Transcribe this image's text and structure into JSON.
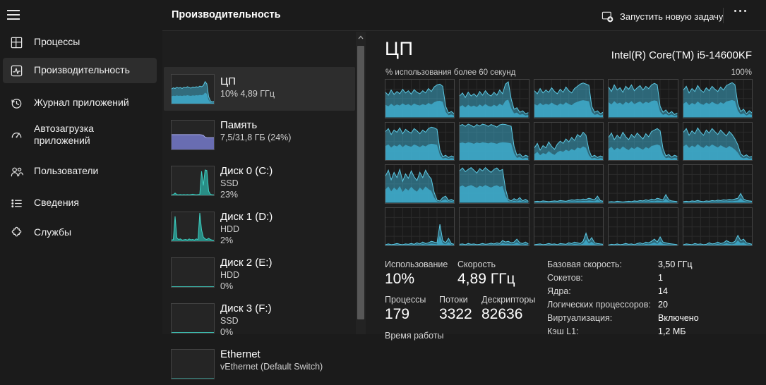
{
  "topbar": {
    "title": "Производительность",
    "run_new_task": "Запустить новую задачу"
  },
  "sidebar": {
    "items": [
      {
        "label": "Процессы",
        "icon": "processes-icon"
      },
      {
        "label": "Производительность",
        "icon": "performance-icon",
        "selected": true
      },
      {
        "label": "Журнал приложений",
        "icon": "app-history-icon"
      },
      {
        "label": "Автозагрузка приложений",
        "icon": "startup-apps-icon"
      },
      {
        "label": "Пользователи",
        "icon": "users-icon"
      },
      {
        "label": "Сведения",
        "icon": "details-icon"
      },
      {
        "label": "Службы",
        "icon": "services-icon"
      }
    ]
  },
  "perf_list": {
    "items": [
      {
        "title": "ЦП",
        "line1": "10% 4,89 ГГц"
      },
      {
        "title": "Память",
        "line1": "7,5/31,8 ГБ (24%)"
      },
      {
        "title": "Диск 0 (C:)",
        "line1": "SSD",
        "line2": "23%"
      },
      {
        "title": "Диск 1 (D:)",
        "line1": "HDD",
        "line2": "2%"
      },
      {
        "title": "Диск 2 (E:)",
        "line1": "HDD",
        "line2": "0%"
      },
      {
        "title": "Диск 3 (F:)",
        "line1": "SSD",
        "line2": "0%"
      },
      {
        "title": "Ethernet",
        "line1": "vEthernet (Default Switch)"
      }
    ]
  },
  "cpu_panel": {
    "title": "ЦП",
    "cpu_name": "Intel(R) Core(TM) i5-14600KF",
    "axis_label": "% использования более 60 секунд",
    "axis_max": "100%",
    "stats_usage": {
      "label": "Использование",
      "value": "10%"
    },
    "stats_speed": {
      "label": "Скорость",
      "value": "4,89 ГГц"
    },
    "stats_processes": {
      "label": "Процессы",
      "value": "179"
    },
    "stats_threads": {
      "label": "Потоки",
      "value": "3322"
    },
    "stats_handles": {
      "label": "Дескрипторы",
      "value": "82636"
    },
    "uptime_label": "Время работы",
    "stats_right": [
      {
        "label": "Базовая скорость:",
        "value": "3,50 ГГц"
      },
      {
        "label": "Сокетов:",
        "value": "1"
      },
      {
        "label": "Ядра:",
        "value": "14"
      },
      {
        "label": "Логических процессоров:",
        "value": "20"
      },
      {
        "label": "Виртуализация:",
        "value": "Включено"
      },
      {
        "label": "Кэш L1:",
        "value": "1,2 МБ"
      }
    ]
  },
  "icons": {
    "topbar": [
      "run-new-task-icon",
      "more-icon"
    ],
    "scrollbar": [
      "chevron-up-icon"
    ],
    "window": [
      "hamburger-menu-icon"
    ]
  },
  "colors": {
    "cpu_fill": "#3ea7c7",
    "cpu_stroke": "#5cc8e2",
    "memory_fill": "#7b80d6",
    "memory_stroke": "#a6aae9",
    "disk_fill": "#2aa79d",
    "disk_stroke": "#3fd0c2",
    "selection_bg": "#2d2d2d",
    "panel_bg": "#1e1e1e"
  },
  "chart_data": {
    "type": "area",
    "title": "% использования более 60 секунд",
    "ylim": [
      0,
      100
    ],
    "grid": true,
    "cores": [
      [
        68,
        60,
        74,
        62,
        70,
        64,
        76,
        66,
        72,
        63,
        75,
        68,
        64,
        72,
        66,
        78,
        70,
        82,
        88,
        90,
        84,
        30,
        12,
        16,
        10
      ],
      [
        58,
        66,
        54,
        68,
        58,
        64,
        56,
        70,
        60,
        72,
        62,
        58,
        68,
        60,
        74,
        64,
        90,
        96,
        50,
        22,
        26,
        14,
        18,
        10,
        13
      ],
      [
        72,
        64,
        78,
        66,
        74,
        68,
        80,
        70,
        64,
        76,
        68,
        82,
        72,
        66,
        78,
        84,
        90,
        93,
        90,
        87,
        30,
        14,
        18,
        10,
        14
      ],
      [
        82,
        70,
        88,
        74,
        80,
        68,
        84,
        76,
        88,
        72,
        80,
        86,
        74,
        84,
        78,
        88,
        92,
        88,
        30,
        14,
        20,
        10,
        16,
        8,
        12
      ],
      [
        74,
        84,
        66,
        78,
        70,
        86,
        74,
        68,
        80,
        72,
        84,
        76,
        70,
        82,
        74,
        86,
        90,
        94,
        88,
        36,
        16,
        22,
        10,
        18,
        12
      ],
      [
        78,
        86,
        70,
        82,
        76,
        88,
        72,
        84,
        78,
        74,
        86,
        80,
        72,
        82,
        76,
        86,
        90,
        88,
        84,
        28,
        10,
        14,
        8,
        12,
        9
      ],
      [
        94,
        97,
        92,
        98,
        95,
        90,
        97,
        93,
        98,
        96,
        92,
        97,
        94,
        90,
        96,
        98,
        97,
        95,
        92,
        38,
        14,
        18,
        9,
        14,
        11
      ],
      [
        34,
        46,
        28,
        40,
        34,
        50,
        38,
        30,
        44,
        52,
        46,
        58,
        50,
        62,
        54,
        70,
        64,
        76,
        68,
        28,
        10,
        14,
        8,
        12,
        9
      ],
      [
        62,
        74,
        56,
        68,
        60,
        76,
        64,
        56,
        70,
        62,
        74,
        66,
        58,
        72,
        64,
        78,
        82,
        86,
        80,
        32,
        12,
        16,
        9,
        14,
        11
      ],
      [
        76,
        86,
        68,
        80,
        72,
        88,
        76,
        68,
        82,
        74,
        86,
        78,
        70,
        82,
        74,
        66,
        78,
        70,
        58,
        42,
        18,
        11,
        15,
        9,
        11
      ],
      [
        72,
        88,
        62,
        82,
        68,
        90,
        58,
        78,
        66,
        86,
        70,
        60,
        82,
        68,
        88,
        74,
        64,
        28,
        7,
        5,
        14,
        18,
        6,
        9,
        5
      ],
      [
        86,
        94,
        84,
        90,
        95,
        88,
        80,
        92,
        86,
        95,
        88,
        82,
        90,
        94,
        86,
        90,
        38,
        9,
        5,
        11,
        7,
        14,
        5,
        9,
        4
      ],
      [
        3,
        4,
        3,
        5,
        4,
        3,
        4,
        5,
        4,
        6,
        5,
        4,
        6,
        8,
        7,
        9,
        8,
        10,
        9,
        12,
        10,
        8,
        18,
        6,
        4
      ],
      [
        2,
        3,
        2,
        4,
        3,
        2,
        3,
        4,
        3,
        5,
        4,
        6,
        5,
        8,
        6,
        10,
        8,
        12,
        10,
        8,
        22,
        8,
        5,
        4,
        3
      ],
      [
        3,
        4,
        3,
        5,
        4,
        6,
        4,
        3,
        5,
        4,
        6,
        5,
        7,
        6,
        8,
        7,
        9,
        8,
        10,
        12,
        25,
        10,
        6,
        5,
        4
      ],
      [
        3,
        5,
        3,
        4,
        6,
        4,
        3,
        5,
        4,
        6,
        4,
        8,
        5,
        10,
        6,
        8,
        12,
        10,
        8,
        58,
        14,
        8,
        20,
        6,
        4
      ],
      [
        4,
        5,
        3,
        6,
        4,
        5,
        3,
        4,
        6,
        4,
        5,
        7,
        5,
        8,
        6,
        14,
        10,
        12,
        8,
        10,
        18,
        8,
        6,
        10,
        5
      ],
      [
        3,
        4,
        5,
        3,
        4,
        6,
        4,
        5,
        3,
        6,
        5,
        4,
        8,
        6,
        10,
        8,
        6,
        12,
        34,
        12,
        22,
        8,
        6,
        5,
        4
      ],
      [
        2,
        4,
        3,
        5,
        3,
        4,
        6,
        4,
        5,
        3,
        6,
        8,
        5,
        10,
        8,
        12,
        18,
        10,
        24,
        10,
        8,
        6,
        5,
        4,
        3
      ],
      [
        3,
        5,
        4,
        3,
        6,
        4,
        5,
        3,
        4,
        8,
        5,
        6,
        10,
        6,
        8,
        14,
        10,
        8,
        12,
        28,
        14,
        18,
        8,
        6,
        4
      ]
    ],
    "thumbs": {
      "cpu": {
        "color_key": "cpu",
        "two_tone": true,
        "values": [
          52,
          56,
          54,
          58,
          55,
          57,
          54,
          58,
          56,
          60,
          57,
          55,
          59,
          57,
          60,
          58,
          62,
          60,
          64,
          78,
          70,
          25,
          10,
          6,
          8
        ]
      },
      "memory": {
        "color_key": "memory",
        "two_tone": false,
        "values": [
          53,
          53,
          53,
          53,
          53,
          53,
          53,
          53,
          53,
          53,
          53,
          53,
          53,
          53,
          53,
          53,
          53,
          52,
          50,
          44,
          42,
          42,
          42,
          42,
          42
        ]
      },
      "disk0": {
        "color_key": "disk",
        "two_tone": false,
        "values": [
          2,
          3,
          8,
          3,
          2,
          3,
          2,
          3,
          2,
          3,
          2,
          3,
          4,
          3,
          2,
          3,
          4,
          85,
          35,
          90,
          88,
          15,
          4,
          2,
          2
        ]
      },
      "disk1": {
        "color_key": "disk",
        "two_tone": false,
        "values": [
          4,
          6,
          88,
          12,
          6,
          8,
          4,
          5,
          6,
          4,
          8,
          5,
          6,
          4,
          8,
          6,
          100,
          40,
          15,
          8,
          6,
          10,
          6,
          4,
          3
        ]
      },
      "disk2": {
        "color_key": "disk",
        "two_tone": false,
        "values": [
          1,
          1,
          1,
          1,
          1,
          1,
          1,
          1,
          1,
          1,
          1,
          1,
          1,
          1,
          1,
          1,
          1,
          1,
          1,
          1,
          1,
          1,
          1,
          1,
          1
        ]
      },
      "disk3": {
        "color_key": "disk",
        "two_tone": false,
        "values": [
          1,
          1,
          1,
          1,
          1,
          1,
          1,
          1,
          1,
          1,
          1,
          1,
          1,
          1,
          1,
          1,
          1,
          1,
          1,
          1,
          1,
          1,
          1,
          1,
          1
        ]
      },
      "ethernet": {
        "color_key": "disk",
        "two_tone": false,
        "values": [
          0,
          0,
          0,
          0,
          0,
          0,
          0,
          0,
          0,
          0,
          0,
          0,
          0,
          0,
          0,
          0,
          0,
          0,
          0,
          0,
          0,
          0,
          0,
          0,
          0
        ]
      }
    }
  }
}
